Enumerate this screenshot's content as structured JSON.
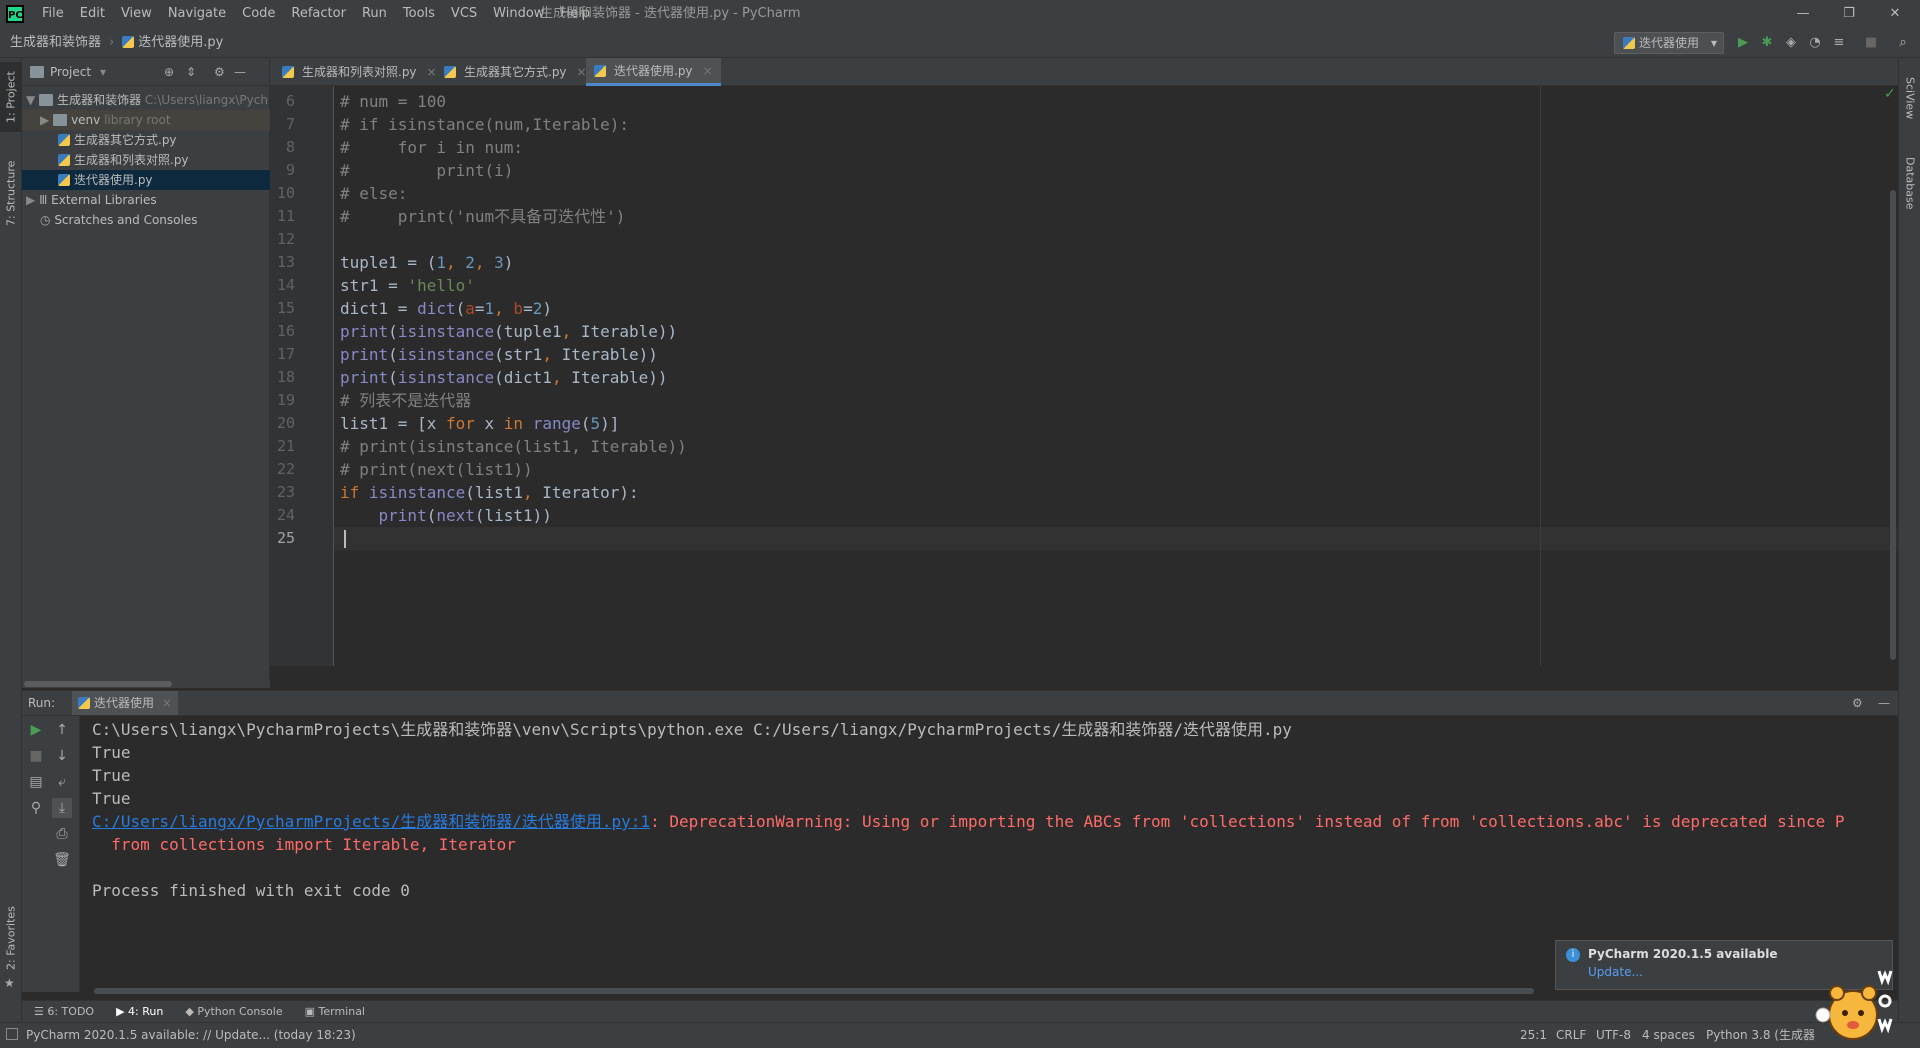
{
  "window": {
    "title": "生成器和装饰器 - 迭代器使用.py - PyCharm",
    "logo_text": "PC",
    "menu": [
      "File",
      "Edit",
      "View",
      "Navigate",
      "Code",
      "Refactor",
      "Run",
      "Tools",
      "VCS",
      "Window",
      "Help"
    ],
    "minimize": "—",
    "restore": "❐",
    "close": "✕"
  },
  "navbar": {
    "crumb_project": "生成器和装饰器",
    "crumb_file": "迭代器使用.py",
    "run_config": "迭代器使用"
  },
  "project_panel": {
    "title": "Project",
    "items": [
      {
        "label": "生成器和装饰器",
        "hint": "C:\\Users\\liangx\\Pych"
      },
      {
        "label": "venv",
        "hint": "library root"
      },
      {
        "label": "生成器其它方式.py",
        "hint": ""
      },
      {
        "label": "生成器和列表对照.py",
        "hint": ""
      },
      {
        "label": "迭代器使用.py",
        "hint": ""
      },
      {
        "label": "External Libraries",
        "hint": ""
      },
      {
        "label": "Scratches and Consoles",
        "hint": ""
      }
    ]
  },
  "left_strip": {
    "project_tab": "1: Project",
    "structure_tab": "7: Structure",
    "favorites_tab": "2: Favorites"
  },
  "right_strip": {
    "sciview_tab": "SciView",
    "database_tab": "Database"
  },
  "editor_tabs": [
    {
      "label": "生成器和列表对照.py",
      "active": false
    },
    {
      "label": "生成器其它方式.py",
      "active": false
    },
    {
      "label": "迭代器使用.py",
      "active": true
    }
  ],
  "editor": {
    "line_numbers": [
      "6",
      "7",
      "8",
      "9",
      "10",
      "11",
      "12",
      "13",
      "14",
      "15",
      "16",
      "17",
      "18",
      "19",
      "20",
      "21",
      "22",
      "23",
      "24",
      "25"
    ],
    "current_line": "25"
  },
  "run_panel": {
    "label": "Run:",
    "tab": "迭代器使用",
    "lines": {
      "cmd": "C:\\Users\\liangx\\PycharmProjects\\生成器和装饰器\\venv\\Scripts\\python.exe C:/Users/liangx/PycharmProjects/生成器和装饰器/迭代器使用.py",
      "out1": "True",
      "out2": "True",
      "out3": "True",
      "link": "C:/Users/liangx/PycharmProjects/生成器和装饰器/迭代器使用.py:1",
      "warning": ": DeprecationWarning: Using or importing the ABCs from 'collections' instead of from 'collections.abc' is deprecated since P",
      "warning2": "  from collections import Iterable, Iterator",
      "finished": "Process finished with exit code 0"
    }
  },
  "notification": {
    "title": "PyCharm 2020.1.5 available",
    "action": "Update..."
  },
  "bottom_tools": [
    "6: TODO",
    "4: Run",
    "Python Console",
    "Terminal"
  ],
  "statusbar": {
    "message": "PyCharm 2020.1.5 available: // Update... (today 18:23)",
    "position": "25:1",
    "line_sep": "CRLF",
    "encoding": "UTF-8",
    "indent": "4 spaces",
    "interpreter": "Python 3.8 (生成器..."
  },
  "colors": {
    "accent": "#4a88c7",
    "run_green": "#499c54",
    "error_red": "#ff6b68"
  }
}
